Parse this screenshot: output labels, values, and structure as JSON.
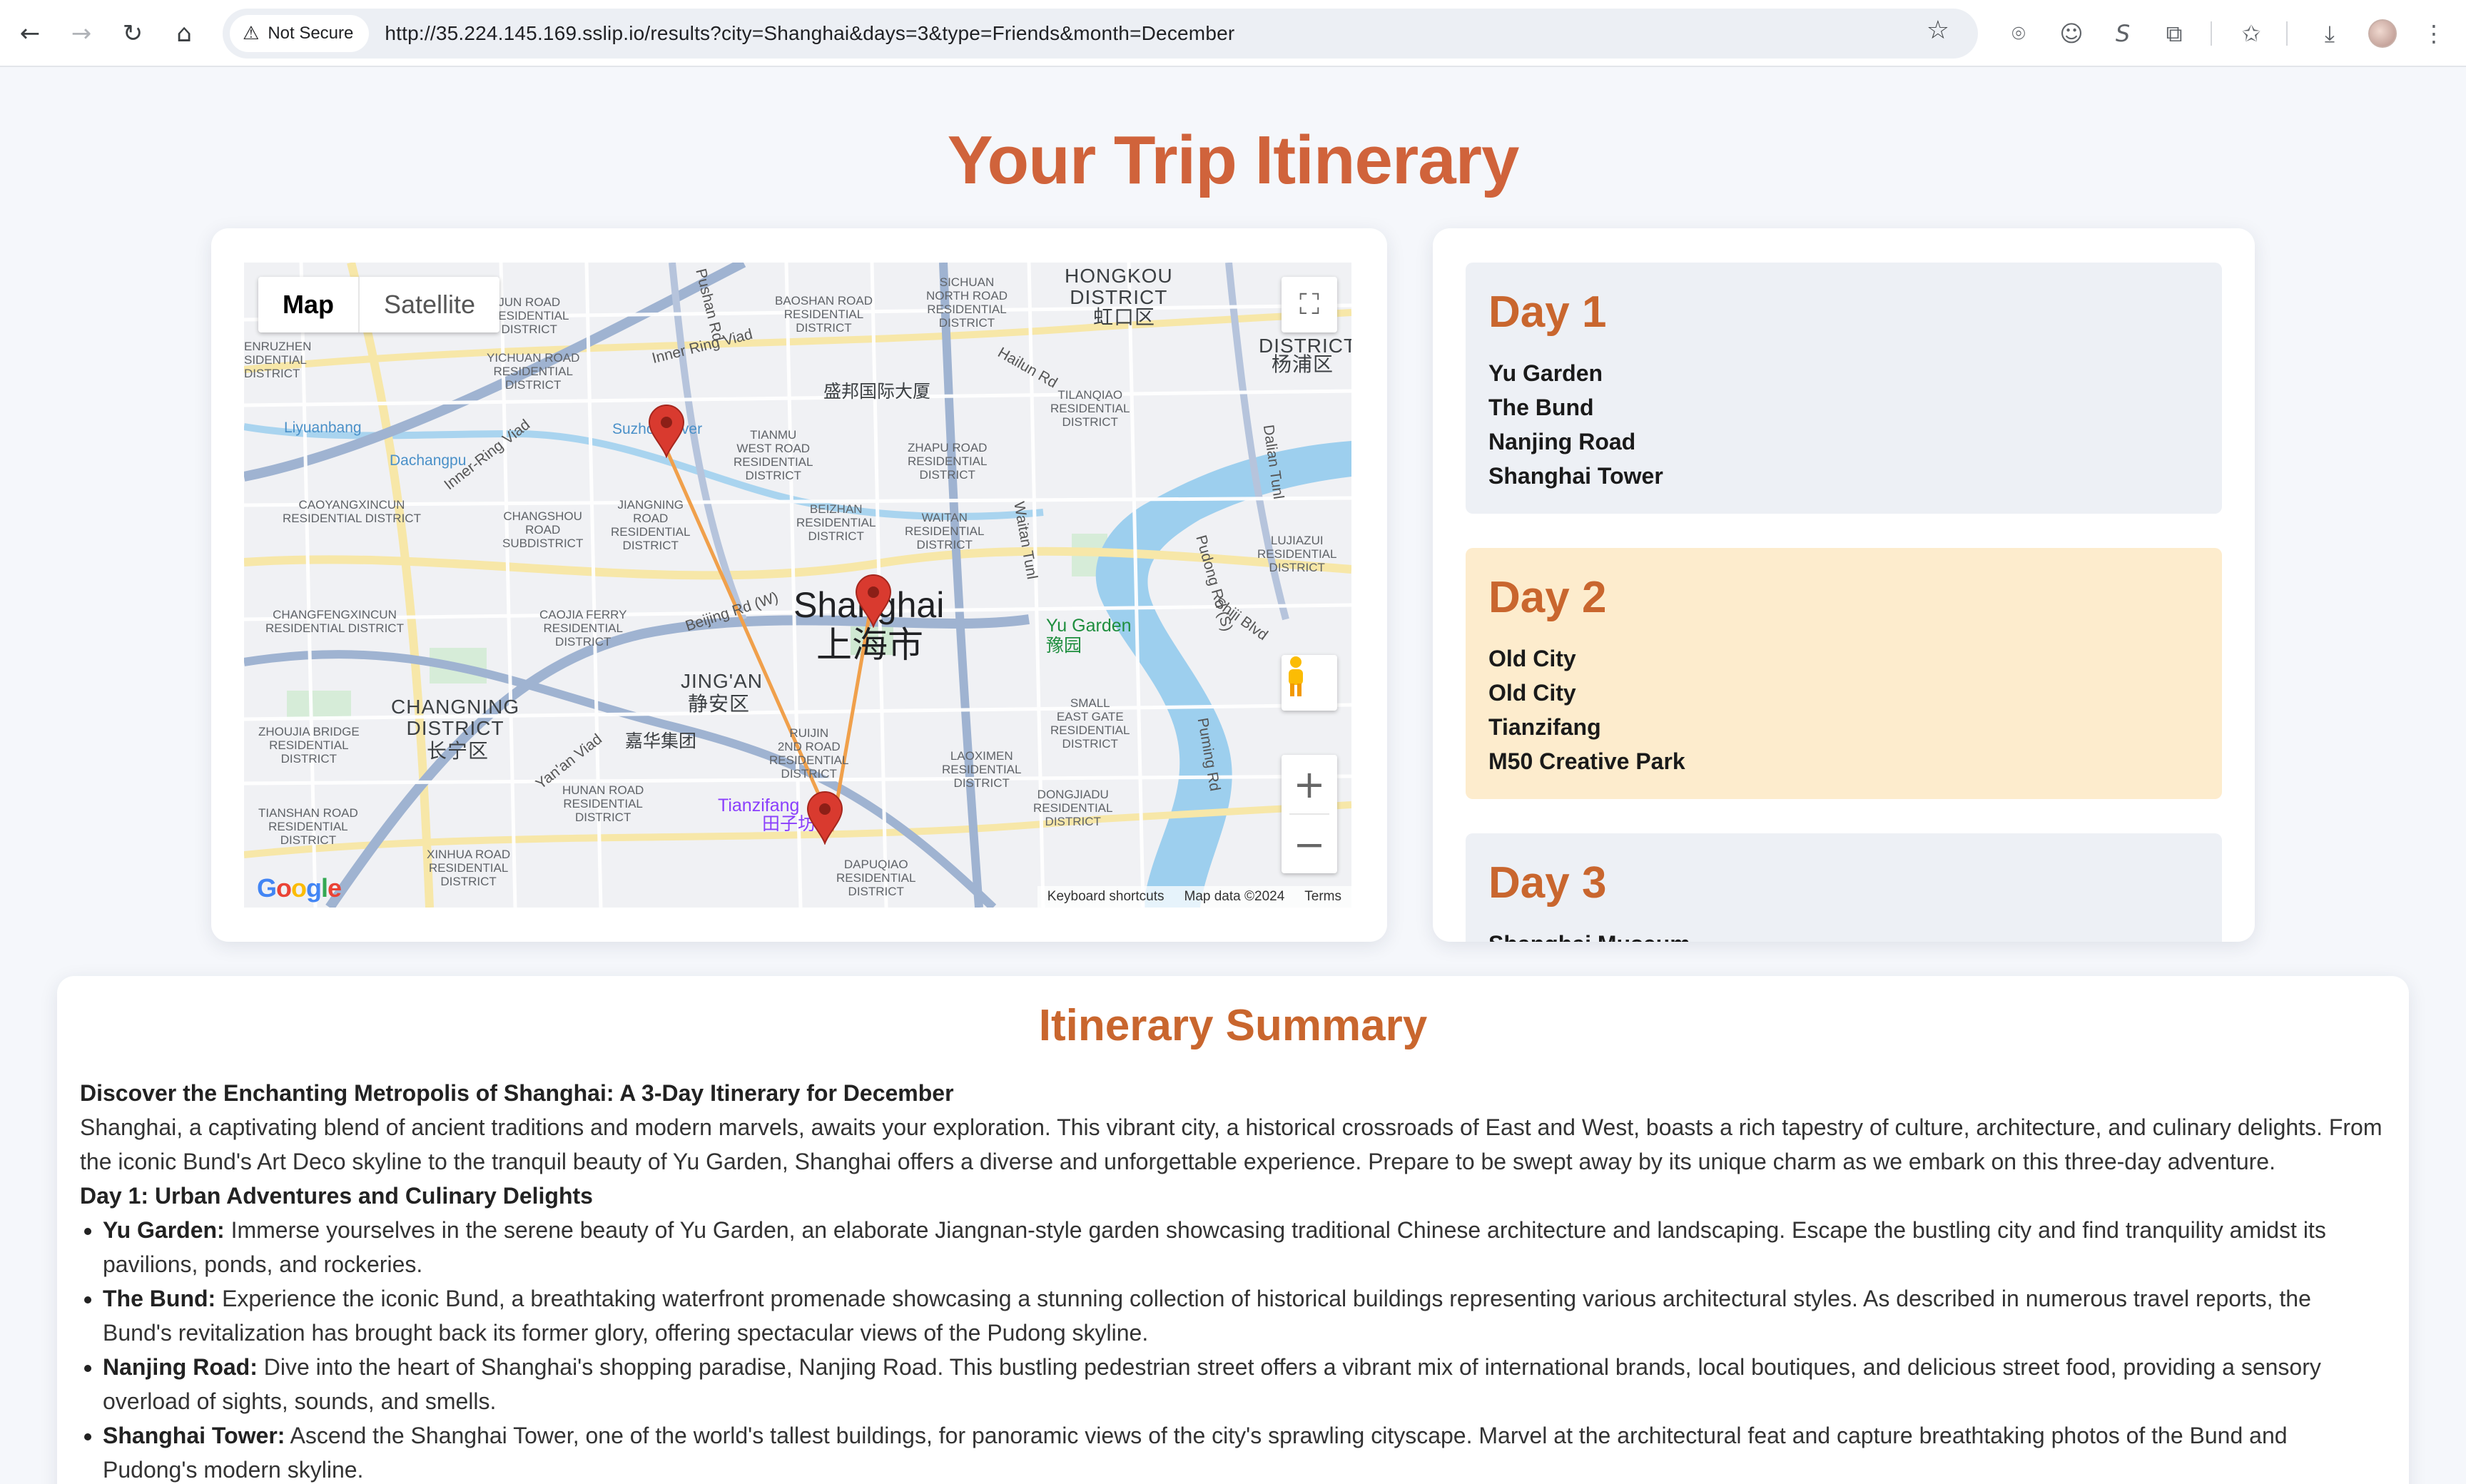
{
  "browser": {
    "security_label": "Not Secure",
    "url": "http://35.224.145.169.sslip.io/results?city=Shanghai&days=3&type=Friends&month=December"
  },
  "page": {
    "title": "Your Trip Itinerary"
  },
  "map": {
    "type_map": "Map",
    "type_satellite": "Satellite",
    "footer_shortcuts": "Keyboard shortcuts",
    "footer_data": "Map data ©2024",
    "footer_terms": "Terms",
    "labels": {
      "hongkou": "HONGKOU\nDISTRICT",
      "hongkou_cn": "虹口区",
      "yangpu": "Y\nDISTRICT",
      "yangpu_cn": "杨浦区",
      "shanghai": "Shanghai",
      "shanghai_cn": "上海市",
      "jingan": "JING'AN",
      "jingan_cn": "静安区",
      "changning": "CHANGNING\nDISTRICT",
      "changning_cn": "长宁区",
      "yu_garden": "Yu Garden",
      "yu_garden_cn": "豫园",
      "tianzifang": "Tianzifang",
      "tianzifang_cn": "田子坊",
      "shengbang": "盛邦国际大厦",
      "jiahua": "嘉华集团",
      "liyuanbang": "Liyuanbang",
      "dachangpu": "Dachangpu",
      "suzhou_river": "Suzhou River",
      "inner_ring": "Inner Ring Viad",
      "inner_ring_2": "Inner-Ring Viad",
      "beijing_rd": "Beijing Rd (W)",
      "yanan_viad": "Yan'an Viad",
      "huangpu_rd": "Waitan Tunl",
      "pudong_rd": "Pudong Rd (S)",
      "shiji_blvd": "Shiji Blvd",
      "puming_rd": "Puming Rd",
      "dalian_tunl": "Dalian Tunl",
      "hailun_rd": "Hailun Rd",
      "pushan_rd": "Pushan Rd",
      "caoyangxincun": "CAOYANGXINCUN\nRESIDENTIAL DISTRICT",
      "changshou": "CHANGSHOU\nROAD\nSUBDISTRICT",
      "jiangning": "JIANGNING\nROAD\nRESIDENTIAL\nDISTRICT",
      "tianmu": "TIANMU\nWEST ROAD\nRESIDENTIAL\nDISTRICT",
      "zhapu": "ZHAPU ROAD\nRESIDENTIAL\nDISTRICT",
      "beizhan": "BEIZHAN\nRESIDENTIAL\nDISTRICT",
      "waitan": "WAITAN\nRESIDENTIAL\nDISTRICT",
      "caojia": "CAOJIA FERRY\nRESIDENTIAL\nDISTRICT",
      "changfeng": "CHANGFENGXINCUN\nRESIDENTIAL DISTRICT",
      "zhoujia": "ZHOUJIA BRIDGE\nRESIDENTIAL\nDISTRICT",
      "hunan": "HUNAN ROAD\nRESIDENTIAL\nDISTRICT",
      "ruijin": "RUIJIN\n2ND ROAD\nRESIDENTIAL\nDISTRICT",
      "laoximen": "LAOXIMEN\nRESIDENTIAL\nDISTRICT",
      "dongjiadu": "DONGJIADU\nRESIDENTIAL\nDISTRICT",
      "small_east": "SMALL\nEAST GATE\nRESIDENTIAL\nDISTRICT",
      "tianshan": "TIANSHAN ROAD\nRESIDENTIAL\nDISTRICT",
      "xinhua": "XINHUA ROAD\nRESIDENTIAL\nDISTRICT",
      "dapuqiao": "DAPUQIAO\nRESIDENTIAL\nDISTRICT",
      "baoshan": "BAOSHAN ROAD\nRESIDENTIAL\nDISTRICT",
      "north_sichuan": "SICHUAN\nNORTH ROAD\nRESIDENTIAL\nDISTRICT",
      "tilanqiao": "TILANQIAO\nRESIDENTIAL\nDISTRICT",
      "lujiazui": "LUJIAZUI\nRESIDENTIAL\nDISTRICT",
      "jun_road": "JUN ROAD\nRESIDENTIAL\nDISTRICT",
      "yichuan": "YICHUAN ROAD\nRESIDENTIAL\nDISTRICT",
      "zhenruzhen": "ENRUZHEN\nSIDENTIAL\nDISTRICT"
    }
  },
  "days": [
    {
      "title": "Day 1",
      "places": [
        "Yu Garden",
        "The Bund",
        "Nanjing Road",
        "Shanghai Tower"
      ]
    },
    {
      "title": "Day 2",
      "places": [
        "Old City",
        "Old City",
        "Tianzifang",
        "M50 Creative Park"
      ]
    },
    {
      "title": "Day 3",
      "places": [
        "Shanghai Museum"
      ]
    }
  ],
  "summary": {
    "title": "Itinerary Summary",
    "heading": "Discover the Enchanting Metropolis of Shanghai: A 3-Day Itinerary for December",
    "intro": "Shanghai, a captivating blend of ancient traditions and modern marvels, awaits your exploration. This vibrant city, a historical crossroads of East and West, boasts a rich tapestry of culture, architecture, and culinary delights. From the iconic Bund's Art Deco skyline to the tranquil beauty of Yu Garden, Shanghai offers a diverse and unforgettable experience. Prepare to be swept away by its unique charm as we embark on this three-day adventure.",
    "day1_heading": "Day 1: Urban Adventures and Culinary Delights",
    "items": [
      {
        "name": "Yu Garden:",
        "text": " Immerse yourselves in the serene beauty of Yu Garden, an elaborate Jiangnan-style garden showcasing traditional Chinese architecture and landscaping. Escape the bustling city and find tranquility amidst its pavilions, ponds, and rockeries."
      },
      {
        "name": "The Bund:",
        "text": " Experience the iconic Bund, a breathtaking waterfront promenade showcasing a stunning collection of historical buildings representing various architectural styles. As described in numerous travel reports, the Bund's revitalization has brought back its former glory, offering spectacular views of the Pudong skyline."
      },
      {
        "name": "Nanjing Road:",
        "text": " Dive into the heart of Shanghai's shopping paradise, Nanjing Road. This bustling pedestrian street offers a vibrant mix of international brands, local boutiques, and delicious street food, providing a sensory overload of sights, sounds, and smells."
      },
      {
        "name": "Shanghai Tower:",
        "text": " Ascend the Shanghai Tower, one of the world's tallest buildings, for panoramic views of the city's sprawling cityscape. Marvel at the architectural feat and capture breathtaking photos of the Bund and Pudong's modern skyline."
      }
    ]
  },
  "colors": {
    "accent": "#d0633b",
    "day_heading": "#c9662e",
    "route": "#f0a04b",
    "marker": "#d93a2f"
  }
}
